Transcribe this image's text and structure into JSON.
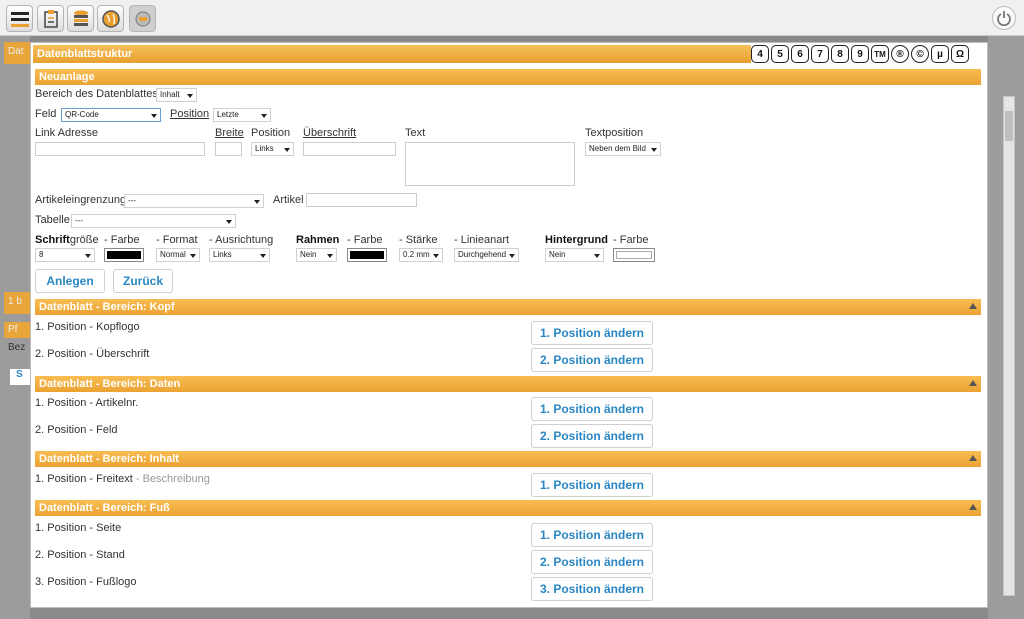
{
  "dialog": {
    "title": "Datenblattstruktur",
    "glyph_buttons": [
      "4",
      "5",
      "6",
      "7",
      "8",
      "9",
      "TM",
      "®",
      "©",
      "µ",
      "Ω"
    ],
    "new_entry_header": "Neuanlage"
  },
  "form": {
    "bereich_label": "Bereich des Datenblattes",
    "bereich_value": "Inhalt",
    "feld_label": "Feld",
    "feld_value": "QR-Code",
    "position_label": "Position",
    "position_value": "Letzte",
    "link_label": "Link Adresse",
    "link_value": "",
    "breite_label": "Breite",
    "breite_value": "",
    "pos2_label": "Position",
    "pos2_value": "Links",
    "ueberschrift_label": "Überschrift",
    "ueberschrift_value": "",
    "text_label": "Text",
    "text_value": "",
    "textposition_label": "Textposition",
    "textposition_value": "Neben dem Bild",
    "artikeleingrenzung_label": "Artikeleingrenzung",
    "artikeleingrenzung_value": "---",
    "artikel_label": "Artikel",
    "artikel_value": "",
    "tabelle_label": "Tabelle",
    "tabelle_value": "---",
    "schrift_bold": "Schrift",
    "schrift_rest": "größe",
    "schrift_value": "8",
    "farbe_label": "- Farbe",
    "format_label": "- Format",
    "format_value": "Normal",
    "ausrichtung_label": "- Ausrichtung",
    "ausrichtung_value": "Links",
    "rahmen_label": "Rahmen",
    "rahmen_value": "Nein",
    "rahmen_farbe_label": "- Farbe",
    "staerke_label": "- Stärke",
    "staerke_value": "0.2 mm",
    "linienart_label": "- Linieanart",
    "linienart_value": "Durchgehend",
    "hintergrund_label": "Hintergrund",
    "hintergrund_value": "Nein",
    "hintergrund_farbe_label": "- Farbe",
    "anlegen_button": "Anlegen",
    "zurueck_button": "Zurück"
  },
  "sections": {
    "kopf": {
      "title": "Datenblatt - Bereich: Kopf",
      "rows": [
        {
          "label": "1. Position - Kopflogo",
          "button": "1. Position ändern"
        },
        {
          "label": "2. Position - Überschrift",
          "button": "2. Position ändern"
        }
      ]
    },
    "daten": {
      "title": "Datenblatt - Bereich: Daten",
      "rows": [
        {
          "label": "1. Position - Artikelnr.",
          "button": "1. Position ändern"
        },
        {
          "label": "2. Position - Feld",
          "button": "2. Position ändern"
        }
      ]
    },
    "inhalt": {
      "title": "Datenblatt - Bereich: Inhalt",
      "rows": [
        {
          "label": "1. Position - Freitext",
          "extra": " - Beschreibung",
          "button": "1. Position ändern"
        }
      ]
    },
    "fuss": {
      "title": "Datenblatt - Bereich: Fuß",
      "rows": [
        {
          "label": "1. Position - Seite",
          "button": "1. Position ändern"
        },
        {
          "label": "2. Position - Stand",
          "button": "2. Position ändern"
        },
        {
          "label": "3. Position - Fußlogo",
          "button": "3. Position ändern"
        }
      ]
    }
  },
  "background": {
    "strip1": "Dat",
    "strip2": "1 b",
    "strip3": "Pf",
    "text1": "Bez",
    "text2": "S"
  },
  "colors": {
    "accent_orange": "#eba232",
    "button_text": "#2a87c4"
  }
}
